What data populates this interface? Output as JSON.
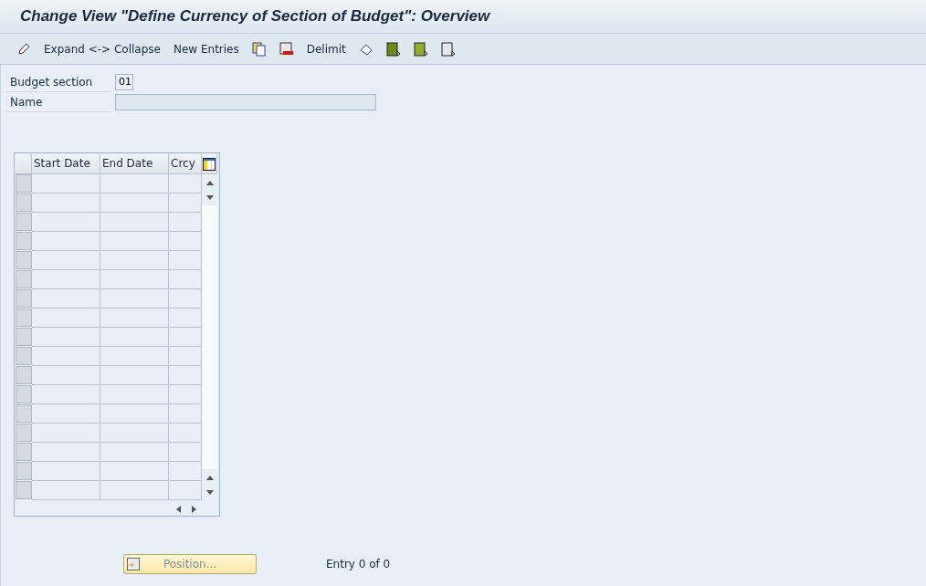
{
  "window": {
    "title": "Change View \"Define Currency of Section of Budget\": Overview"
  },
  "toolbar": [
    {
      "kind": "icon"
    },
    {
      "kind": "text",
      "label": "Expand <-> Collapse"
    },
    {
      "kind": "text",
      "label": "New Entries"
    },
    {
      "kind": "icon"
    },
    {
      "kind": "icon"
    },
    {
      "kind": "text",
      "label": "Delimit"
    },
    {
      "kind": "icon"
    },
    {
      "kind": "icon"
    },
    {
      "kind": "icon"
    },
    {
      "kind": "icon"
    }
  ],
  "fields": [
    {
      "label": "Budget section",
      "value": "01",
      "kind": "short"
    },
    {
      "label": "Name",
      "kind": "long"
    }
  ],
  "table": {
    "columns": [
      "Start Date",
      "End Date",
      "Crcy"
    ]
  },
  "position_button": {
    "label": "Position...",
    "disabled": true
  },
  "entry_count": "Entry 0 of 0"
}
